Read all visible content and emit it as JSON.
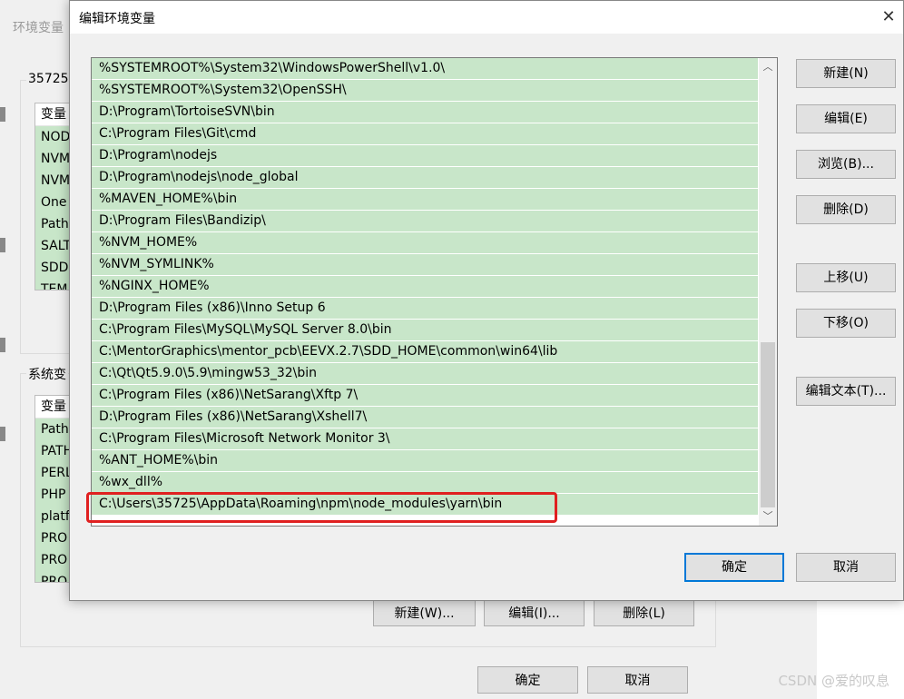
{
  "background_dialog": {
    "title": "环境变量",
    "user_group_label": "35725",
    "system_group_label": "系统变",
    "user_list": {
      "header": "变量",
      "rows": [
        "NOD",
        "NVM",
        "NVM",
        "One",
        "Path",
        "SALT",
        "SDD",
        "TEM"
      ]
    },
    "system_list": {
      "header": "变量",
      "rows": [
        "Path",
        "PATH",
        "PERL",
        "PHP",
        "platf",
        "PRO",
        "PRO",
        "PRO"
      ]
    },
    "buttons": {
      "new": "新建(W)...",
      "edit": "编辑(I)...",
      "delete": "删除(L)"
    },
    "ok": "确定",
    "cancel": "取消"
  },
  "dialog": {
    "title": "编辑环境变量",
    "close_glyph": "✕",
    "paths": [
      "%SYSTEMROOT%\\System32\\WindowsPowerShell\\v1.0\\",
      "%SYSTEMROOT%\\System32\\OpenSSH\\",
      "D:\\Program\\TortoiseSVN\\bin",
      "C:\\Program Files\\Git\\cmd",
      "D:\\Program\\nodejs",
      "D:\\Program\\nodejs\\node_global",
      "%MAVEN_HOME%\\bin",
      "D:\\Program Files\\Bandizip\\",
      "%NVM_HOME%",
      "%NVM_SYMLINK%",
      "%NGINX_HOME%",
      "D:\\Program Files (x86)\\Inno Setup 6",
      "C:\\Program Files\\MySQL\\MySQL Server 8.0\\bin",
      "C:\\MentorGraphics\\mentor_pcb\\EEVX.2.7\\SDD_HOME\\common\\win64\\lib",
      "C:\\Qt\\Qt5.9.0\\5.9\\mingw53_32\\bin",
      "C:\\Program Files (x86)\\NetSarang\\Xftp 7\\",
      "D:\\Program Files (x86)\\NetSarang\\Xshell7\\",
      "C:\\Program Files\\Microsoft Network Monitor 3\\",
      "%ANT_HOME%\\bin",
      "%wx_dll%",
      "C:\\Users\\35725\\AppData\\Roaming\\npm\\node_modules\\yarn\\bin"
    ],
    "buttons": {
      "new": "新建(N)",
      "edit": "编辑(E)",
      "browse": "浏览(B)...",
      "delete": "删除(D)",
      "move_up": "上移(U)",
      "move_down": "下移(O)",
      "edit_text": "编辑文本(T)...",
      "ok": "确定",
      "cancel": "取消"
    },
    "scrollbar": {
      "up_glyph": "︿",
      "down_glyph": "﹀"
    }
  },
  "watermark": "CSDN @爱的叹息",
  "colors": {
    "row_bg": "#c8e6c9",
    "highlight": "#e02020",
    "focus": "#0078d7"
  }
}
